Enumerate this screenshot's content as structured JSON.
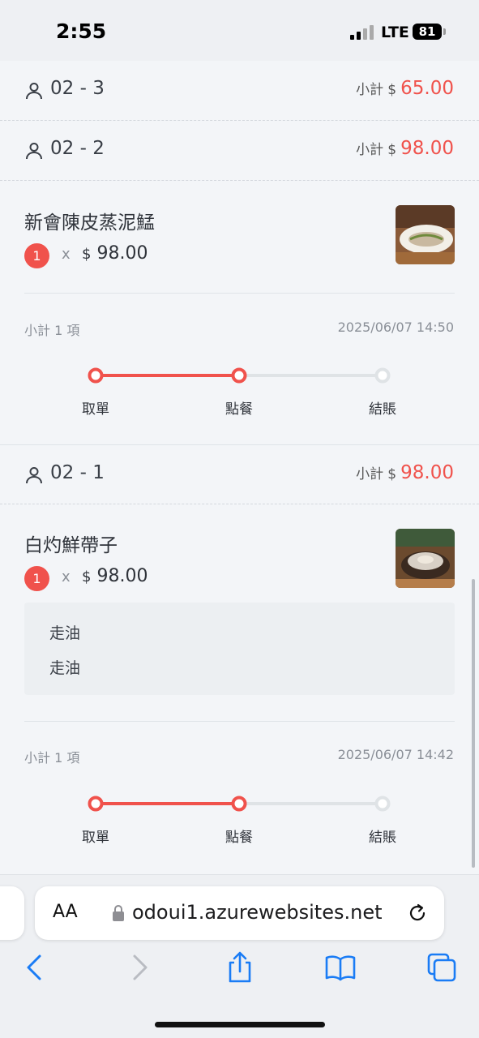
{
  "status_bar": {
    "time": "2:55",
    "network": "LTE",
    "battery": "81"
  },
  "currency_symbol": "$",
  "subtotal_label": "小計",
  "qty_separator": "x",
  "steps": [
    "取單",
    "點餐",
    "結賬"
  ],
  "tables": [
    {
      "label": "02 - 3",
      "subtotal": "65.00"
    },
    {
      "label": "02 - 2",
      "subtotal": "98.00",
      "order": {
        "dish": "新會陳皮蒸泥鯭",
        "qty": "1",
        "price": "98.00",
        "summary": "小計 1 項",
        "timestamp": "2025/06/07 14:50",
        "steps_completed": 2
      }
    },
    {
      "label": "02 - 1",
      "subtotal": "98.00",
      "order": {
        "dish": "白灼鮮帶子",
        "qty": "1",
        "price": "98.00",
        "notes": [
          "走油",
          "走油"
        ],
        "summary": "小計 1 項",
        "timestamp": "2025/06/07 14:42",
        "steps_completed": 2
      }
    }
  ],
  "browser": {
    "text_size_button": "AA",
    "url": "odoui1.azurewebsites.net"
  },
  "colors": {
    "accent": "#f0524c",
    "inactive": "#dfe3e6"
  }
}
